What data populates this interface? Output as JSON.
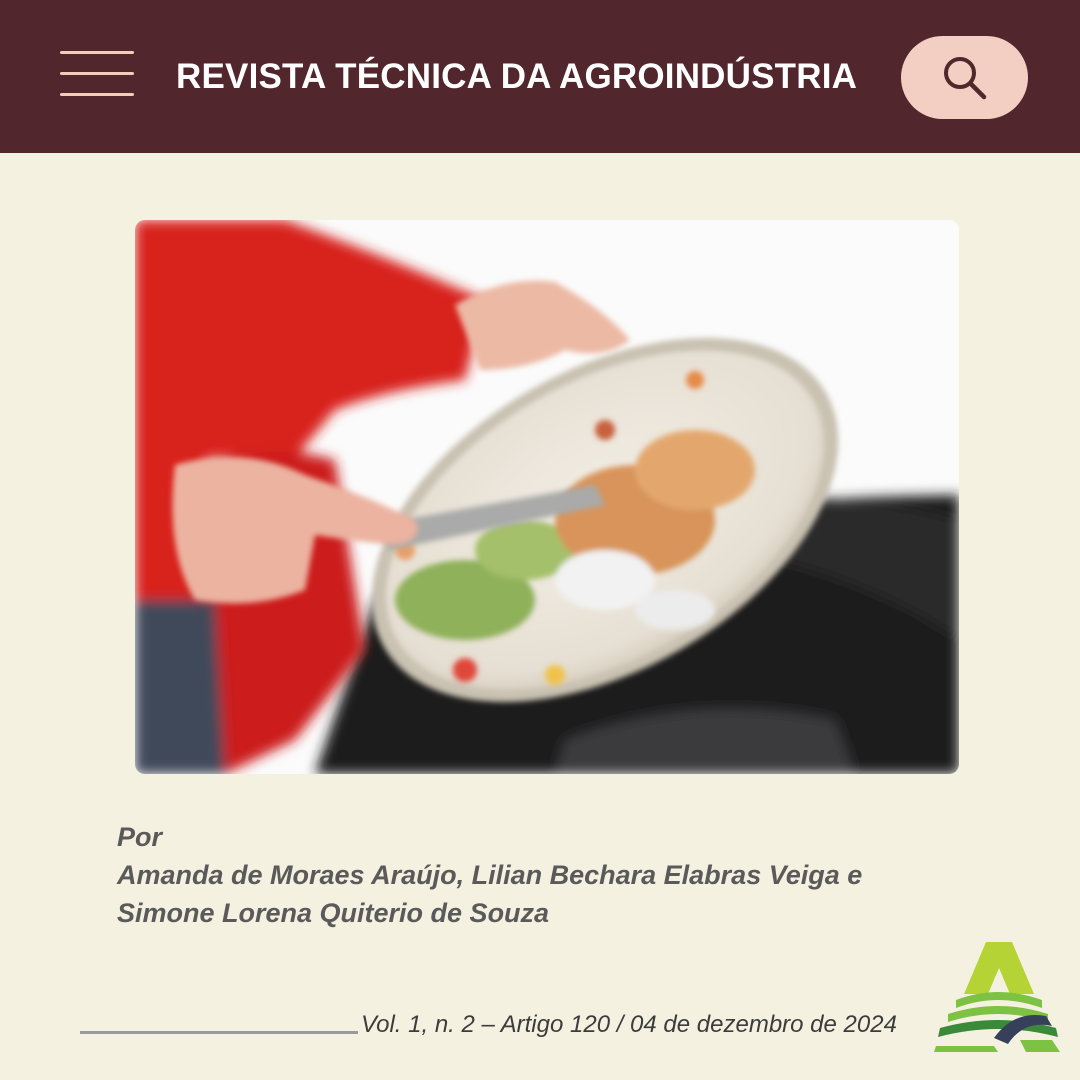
{
  "header": {
    "title": "REVISTA TÉCNICA DA AGROINDÚSTRIA",
    "menu_icon": "hamburger-menu-icon",
    "search_icon": "search-icon"
  },
  "image": {
    "subject": "hands scraping leftover food from a plate into a black trash bin"
  },
  "byline": {
    "prefix": "Por",
    "authors_line1": "Amanda de Moraes Araújo, Lilian Bechara Elabras Veiga e",
    "authors_line2": "Simone Lorena Quiterio de Souza"
  },
  "footer": {
    "citation": "Vol. 1, n. 2 – Artigo 120 / 04 de dezembro de 2024",
    "logo_icon": "agro-a-logo"
  },
  "colors": {
    "header_bg": "#52262d",
    "page_bg": "#f5f1e1",
    "accent_pink": "#f2cfc2",
    "text_gray": "#5a5a5a",
    "logo_green": "#7dc242"
  }
}
